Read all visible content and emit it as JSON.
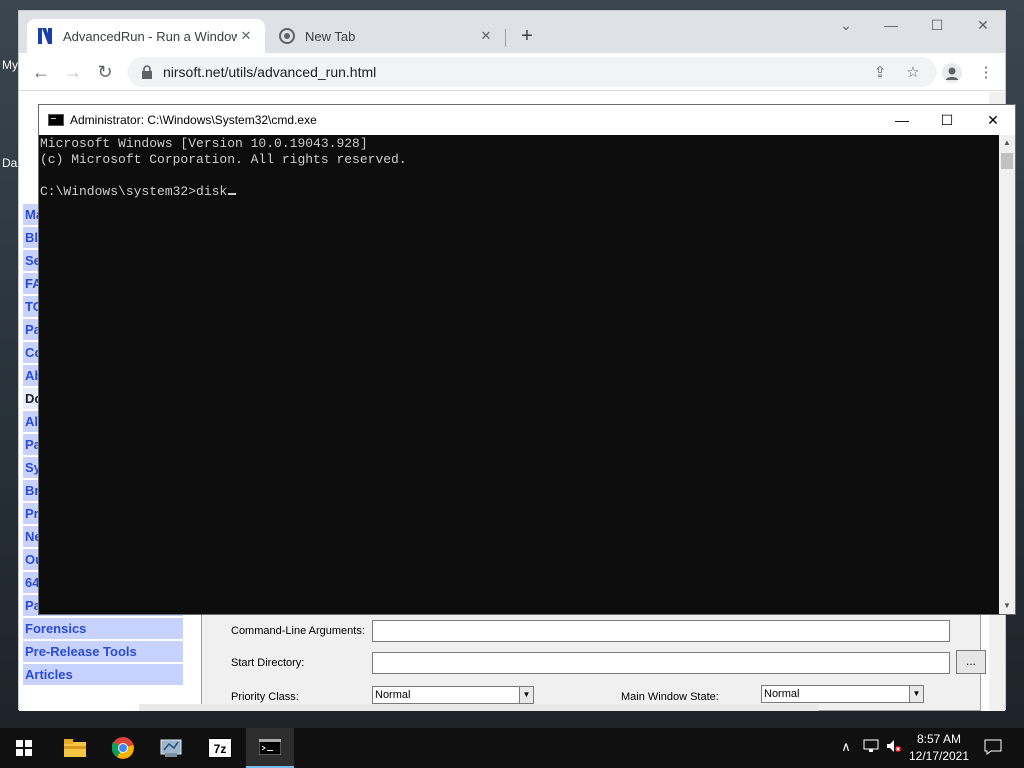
{
  "desktop": {
    "edge_label_1": "My",
    "edge_label_2": "Da"
  },
  "browser": {
    "tabs": [
      {
        "title": "AdvancedRun - Run a Windows p",
        "active": true,
        "icon": "nirsoft-icon"
      },
      {
        "title": "New Tab",
        "active": false,
        "icon": "chrome-icon"
      }
    ],
    "new_tab_label": "+",
    "url": "nirsoft.net/utils/advanced_run.html"
  },
  "page": {
    "sidebar": [
      "Ma",
      "Blo",
      "Se",
      "FA",
      "TO",
      "Pa",
      "Co",
      "Ab",
      "Do",
      "All",
      "Pa",
      "Sy",
      "Br",
      "Pr",
      "Ne",
      "Ou",
      "64",
      "Pa",
      "Forensics",
      "Pre-Release Tools",
      "Articles"
    ],
    "form": {
      "cmdline_label": "Command-Line Arguments:",
      "startdir_label": "Start Directory:",
      "browse_label": "...",
      "priority_label": "Priority Class:",
      "priority_value": "Normal",
      "winstate_label": "Main Window State:",
      "winstate_value": "Normal"
    }
  },
  "cmd": {
    "title": "Administrator: C:\\Windows\\System32\\cmd.exe",
    "lines": [
      "Microsoft Windows [Version 10.0.19043.928]",
      "(c) Microsoft Corporation. All rights reserved.",
      "",
      "C:\\Windows\\system32>disk"
    ]
  },
  "taskbar": {
    "apps": [
      "start-icon",
      "file-explorer-icon",
      "chrome-icon",
      "control-panel-icon",
      "7zip-icon",
      "cmd-icon"
    ],
    "zip_label": "7z",
    "time": "8:57 AM",
    "date": "12/17/2021"
  }
}
